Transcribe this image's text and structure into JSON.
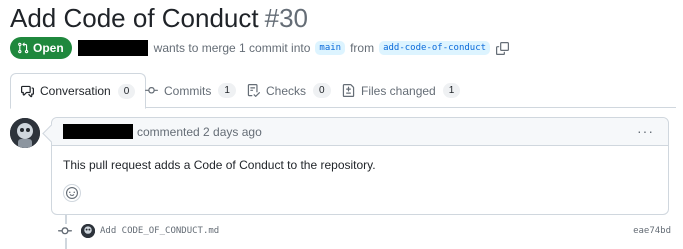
{
  "pr": {
    "title": "Add Code of Conduct",
    "number": "#30",
    "state": "Open",
    "merge_text": "wants to merge 1 commit into",
    "base_branch": "main",
    "from_text": "from",
    "head_branch": "add-code-of-conduct"
  },
  "tabs": [
    {
      "label": "Conversation",
      "count": "0",
      "icon": "comment-discussion-icon"
    },
    {
      "label": "Commits",
      "count": "1",
      "icon": "git-commit-icon"
    },
    {
      "label": "Checks",
      "count": "0",
      "icon": "checklist-icon"
    },
    {
      "label": "Files changed",
      "count": "1",
      "icon": "file-diff-icon"
    }
  ],
  "comment": {
    "action": "commented 2 days ago",
    "body": "This pull request adds a Code of Conduct to the repository.",
    "menu": "···"
  },
  "commit": {
    "message": "Add CODE_OF_CONDUCT.md",
    "sha": "eae74bd"
  },
  "colors": {
    "open_green": "#1f883d",
    "branch_bg": "#ddf4ff",
    "branch_fg": "#0969da",
    "border": "#d0d7de"
  }
}
